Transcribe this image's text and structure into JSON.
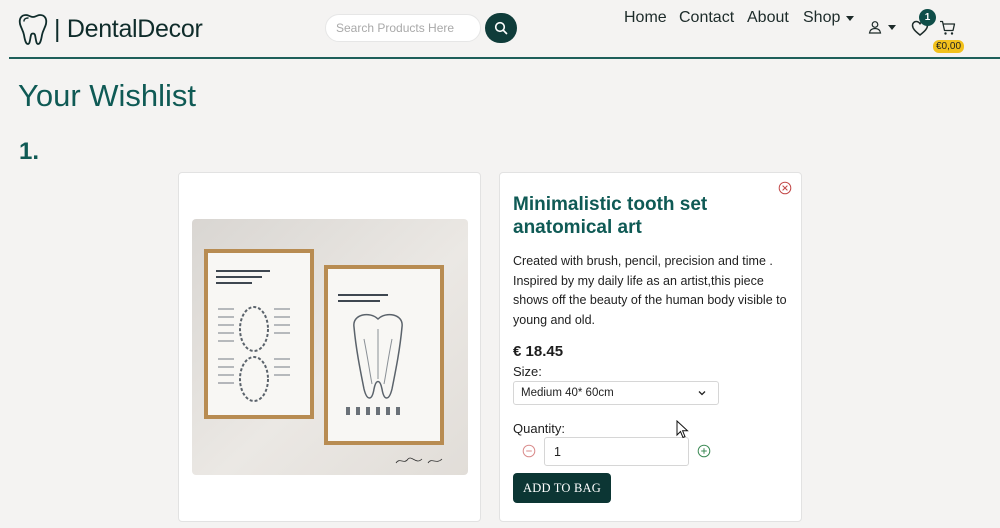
{
  "brand": {
    "name": "| DentalDecor"
  },
  "search": {
    "placeholder": "Search Products Here"
  },
  "nav": {
    "home": "Home",
    "contact": "Contact",
    "about": "About",
    "shop": "Shop"
  },
  "wishlist": {
    "count": "1"
  },
  "cart": {
    "total": "€0,00"
  },
  "page": {
    "title": "Your Wishlist"
  },
  "items": [
    {
      "index": "1.",
      "title": "Minimalistic tooth set anatomical art",
      "description": "Created with brush, pencil, precision and time . Inspired by my daily life as an artist,this piece shows off the beauty of the human body visible to young and old.",
      "price": "€ 18.45",
      "size_label": "Size:",
      "size_value": "Medium 40* 60cm",
      "quantity_label": "Quantity:",
      "quantity_value": "1",
      "add_button": "ADD TO BAG",
      "image": {
        "poster_left_title": "INTERNATIONAL DENTAL NUMBERING SYSTEMS",
        "poster_right_title": "DENTAL ANATOMY OF A HUMAN TOOTH",
        "signature": "Smell and Keller"
      }
    }
  ],
  "colors": {
    "accent": "#0f5a55",
    "button": "#0c3634",
    "badge": "#f2c11c"
  }
}
